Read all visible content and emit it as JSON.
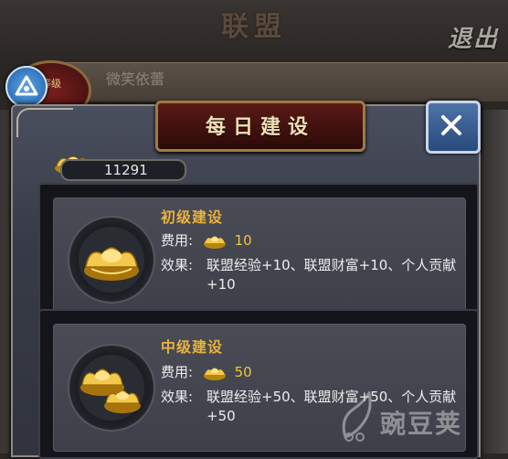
{
  "background": {
    "title": "联盟",
    "exit_label": "退出",
    "username": "微笑依蕾",
    "level_badge": "等级"
  },
  "dialog": {
    "title": "每日建设",
    "close_label": "X"
  },
  "currency": {
    "icon": "gold-ingot-icon",
    "amount": "11291"
  },
  "options": [
    {
      "name": "初级建设",
      "cost_label": "费用:",
      "cost_value": "10",
      "effect_label": "效果:",
      "effect_text": "联盟经验+10、联盟财富+10、个人贡献+10"
    },
    {
      "name": "中级建设",
      "cost_label": "费用:",
      "cost_value": "50",
      "effect_label": "效果:",
      "effect_text": "联盟经验+50、联盟财富+50、个人贡献+50"
    }
  ],
  "watermark": {
    "text": "豌豆荚"
  },
  "colors": {
    "accent_gold": "#e8b23a",
    "cost_gold": "#f0c53a",
    "close_button": "#284a7c",
    "title_plate": "#5a1a16"
  }
}
